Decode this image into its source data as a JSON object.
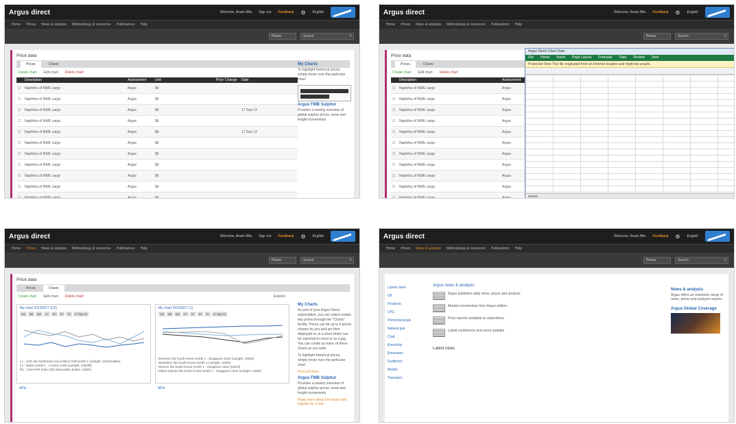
{
  "app": {
    "brand": "Argus direct",
    "user": "Welcome, Arash Afta",
    "signout": "Sign out",
    "feedback": "Feedback",
    "language": "English"
  },
  "nav": [
    "Home",
    "Prices",
    "News & analysis",
    "Methodology & resources",
    "Publications",
    "Help"
  ],
  "toolbar": {
    "select": "Prices",
    "search_placeholder": "Search"
  },
  "prices": {
    "title": "Price data",
    "tabs": [
      "Prices",
      "Charts"
    ],
    "actions": [
      "Create chart",
      "Edit chart",
      "Delete chart"
    ],
    "exports": "Exports",
    "columns": [
      "Description",
      "Assessment",
      "Unit",
      "",
      "",
      "Price",
      "Change",
      "Date",
      ""
    ],
    "rows": [
      {
        "desc": "Naphtha cif NWE cargo",
        "basis": "Argus",
        "unit": "$/t",
        "price": "",
        "chg": "",
        "date": "",
        "dir": ""
      },
      {
        "desc": "Naphtha cif NWE cargo",
        "basis": "Argus",
        "unit": "$/t",
        "price": "",
        "chg": "",
        "date": "",
        "dir": ""
      },
      {
        "desc": "Naphtha cif NWE cargo",
        "basis": "Argus",
        "unit": "$/t",
        "price": "",
        "chg": "",
        "date": "17 Sep 13",
        "dir": "up"
      },
      {
        "desc": "Naphtha cif NWE cargo",
        "basis": "Argus",
        "unit": "$/t",
        "price": "",
        "chg": "",
        "date": "",
        "dir": ""
      },
      {
        "desc": "Naphtha cif NWE cargo",
        "basis": "Argus",
        "unit": "$/t",
        "price": "",
        "chg": "",
        "date": "17 Sep 13",
        "dir": "up"
      },
      {
        "desc": "Naphtha cif NWE cargo",
        "basis": "Argus",
        "unit": "$/t",
        "price": "",
        "chg": "",
        "date": "",
        "dir": ""
      },
      {
        "desc": "Naphtha cif NWE cargo",
        "basis": "Argus",
        "unit": "$/t",
        "price": "",
        "chg": "",
        "date": "",
        "dir": ""
      },
      {
        "desc": "Naphtha cif NWE cargo",
        "basis": "Argus",
        "unit": "$/t",
        "price": "",
        "chg": "",
        "date": "",
        "dir": "down"
      },
      {
        "desc": "Naphtha cif NWE cargo",
        "basis": "Argus",
        "unit": "$/t",
        "price": "",
        "chg": "",
        "date": "",
        "dir": "down"
      },
      {
        "desc": "Naphtha cif NWE cargo",
        "basis": "Argus",
        "unit": "$/t",
        "price": "",
        "chg": "",
        "date": "",
        "dir": ""
      },
      {
        "desc": "Naphtha cif NWE cargo",
        "basis": "Argus",
        "unit": "$/t",
        "price": "",
        "chg": "",
        "date": "",
        "dir": ""
      }
    ]
  },
  "side": {
    "charts_title": "My Charts",
    "charts_text": "As part of your Argus Direct subscription, you can select certain key prices through the \"Charts\" facility. These can be up to 4 prices chosen by you and are then displayed on in a chart which can be exported to excel or as a jpg. You can create as many of these charts as you wish.",
    "charts_hint": "To highlight historical prices, simply hover over the particular chart.",
    "find_more": "Find out more",
    "fmb_title": "Argus FMB Sulphur",
    "fmb_text": "Provides a weekly overview of global sulphur prices, news and freight movements",
    "fmb_link": "Read more about the report and register for a trial."
  },
  "charts": {
    "chart1_title": "My chart 2013/9/17 (U2)",
    "chart2_title": "My chart 2013/9/17 (1)",
    "ranges": [
      "1M",
      "3M",
      "6M",
      "1Y",
      "3Y",
      "5Y"
    ],
    "to": "To",
    "date": "17 Sep 13",
    "legend1": [
      "L1 : LNG des Northeast Asia (ANEA) half-month 1 (outright, USD/mmBtu)",
      "L2 : Dubai month 1 - London close (outright, USD/bl)",
      "R1 : Coal API6 Index (fob Newcastle) (Index, USD/t)"
    ],
    "legend2": [
      "Benzene fob South Korea month 1 - Singapore close (outright, USD/t)",
      "Butadiene fob South Korea month 1 (outright, USD/t)",
      "Styrene fob South Korea month 1 - Singapore close (USD/t)",
      "Mixed xylenes fob South Korea month 1 - Singapore close (outright, USD/t)"
    ],
    "next1": "APIs",
    "next2": "APIs"
  },
  "excel": {
    "title": "Argus Direct Chart Data",
    "ribbon": [
      "File",
      "Home",
      "Insert",
      "Page Layout",
      "Formulas",
      "Data",
      "Review",
      "View"
    ],
    "warning": "Protected View  This file originated from an Internet location and might be unsafe.",
    "sheet": "Sheet1"
  },
  "news": {
    "left": [
      "Latest news",
      "Oil",
      "Products",
      "LPG",
      "Petrochemicals",
      "Natural gas",
      "Coal",
      "Electricity",
      "Emissions",
      "Fertilizers",
      "Metals",
      "Transport"
    ],
    "headline_label": "Argus news & analysis",
    "items": [
      "Argus publishes daily news, prices and analysis",
      "Market commentary from Argus editors",
      "Price reports available to subscribers",
      "Latest conference and event updates"
    ],
    "side_title": "News & analysis",
    "side_text": "Argus offers an extensive range of news, prices and analysis reports.",
    "side_title2": "Argus Global Coverage",
    "latest_label": "Latest news"
  }
}
